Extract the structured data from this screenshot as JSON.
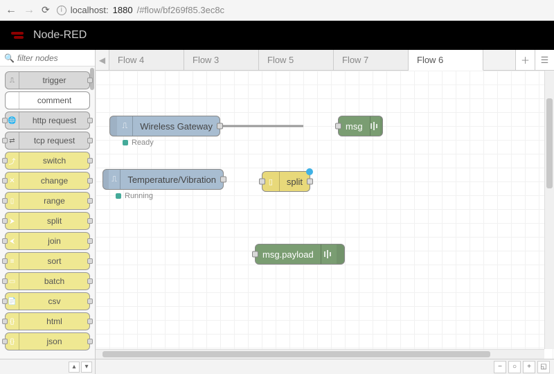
{
  "browser": {
    "url_host": "localhost:",
    "url_port": "1880",
    "url_path": "/#flow/bf269f85.3ec8c"
  },
  "header": {
    "title": "Node-RED"
  },
  "palette": {
    "search_placeholder": "filter nodes",
    "nodes": [
      {
        "label": "trigger",
        "style": "grey"
      },
      {
        "label": "comment",
        "style": "white"
      },
      {
        "label": "http request",
        "style": "grey"
      },
      {
        "label": "tcp request",
        "style": "grey"
      },
      {
        "label": "switch",
        "style": "yellow"
      },
      {
        "label": "change",
        "style": "yellow"
      },
      {
        "label": "range",
        "style": "yellow"
      },
      {
        "label": "split",
        "style": "yellow"
      },
      {
        "label": "join",
        "style": "yellow"
      },
      {
        "label": "sort",
        "style": "yellow"
      },
      {
        "label": "batch",
        "style": "yellow"
      },
      {
        "label": "csv",
        "style": "yellow"
      },
      {
        "label": "html",
        "style": "yellow"
      },
      {
        "label": "json",
        "style": "yellow"
      }
    ]
  },
  "tabs": {
    "items": [
      "Flow 4",
      "Flow 3",
      "Flow 5",
      "Flow 7",
      "Flow 6"
    ],
    "active_index": 4
  },
  "canvas": {
    "nodes": {
      "gateway": {
        "label": "Wireless Gateway",
        "status": "Ready"
      },
      "msg1": {
        "label": "msg"
      },
      "tempvib": {
        "label": "Temperature/Vibration",
        "status": "Running"
      },
      "split": {
        "label": "split"
      },
      "msgpayload": {
        "label": "msg.payload"
      }
    }
  }
}
